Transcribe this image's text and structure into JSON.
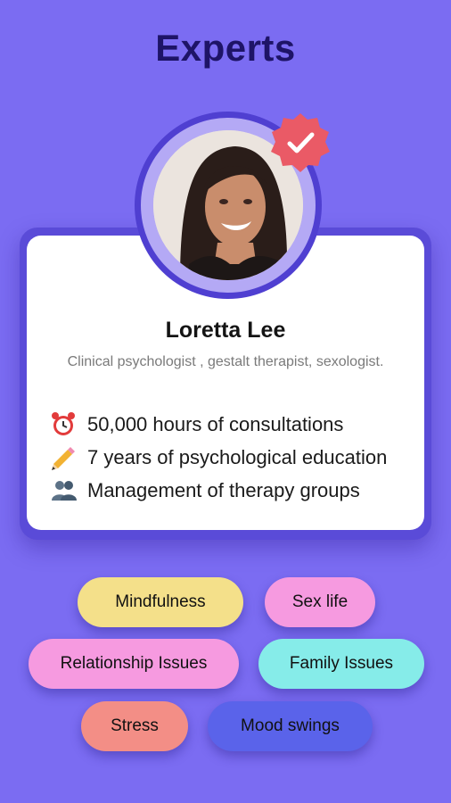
{
  "header": {
    "title": "Experts"
  },
  "expert": {
    "name": "Loretta Lee",
    "role": "Clinical psychologist , gestalt therapist, sexologist.",
    "facts": [
      {
        "icon": "alarm-clock-icon",
        "text": "50,000 hours of consultations"
      },
      {
        "icon": "pencil-icon",
        "text": "7 years of psychological education"
      },
      {
        "icon": "people-icon",
        "text": "Management of therapy groups"
      }
    ]
  },
  "tags": [
    {
      "label": "Mindfulness",
      "color": "#f4e08a"
    },
    {
      "label": "Sex life",
      "color": "#f69ae0"
    },
    {
      "label": "Relationship Issues",
      "color": "#f69ae0"
    },
    {
      "label": "Family Issues",
      "color": "#86ece9"
    },
    {
      "label": "Stress",
      "color": "#f38e86"
    },
    {
      "label": "Mood swings",
      "color": "#5a63ea"
    }
  ],
  "colors": {
    "background": "#7b6cf2",
    "title": "#1e1467",
    "card_border": "#5a4bd8",
    "badge": "#ea5a66"
  }
}
